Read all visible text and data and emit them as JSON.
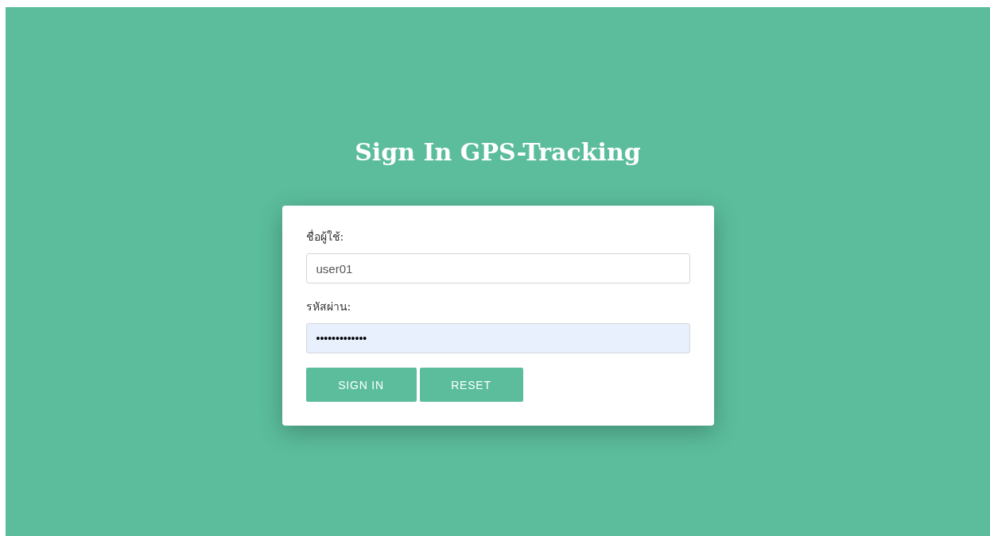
{
  "title": "Sign In GPS-Tracking",
  "fields": [
    {
      "label": "ชื่อผู้ใช้:",
      "kind": "text",
      "value": "user01",
      "autofilled": false
    },
    {
      "label": "รหัสผ่าน:",
      "kind": "password",
      "value": "•••••••••••••",
      "autofilled": true
    }
  ],
  "buttons": [
    "SIGN IN",
    "RESET"
  ]
}
